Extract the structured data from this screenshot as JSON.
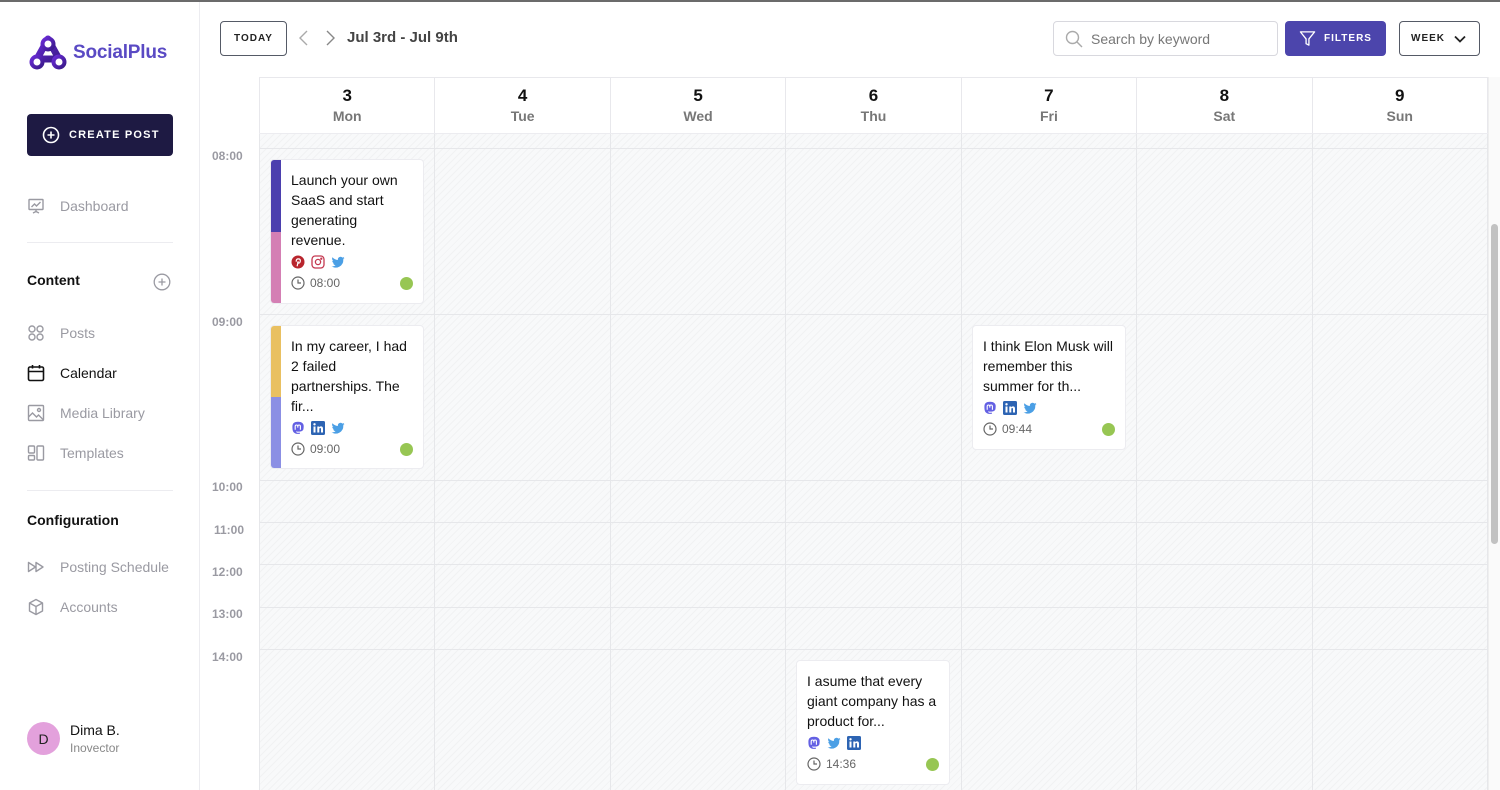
{
  "app": {
    "name": "SocialPlus",
    "brand_color": "#5a4ac4"
  },
  "sidebar": {
    "create_post_label": "CREATE POST",
    "dashboard": {
      "label": "Dashboard",
      "icon": "presentation-chart-icon"
    },
    "content_section": {
      "title": "Content",
      "add_icon": "plus-circle-icon",
      "items": [
        {
          "label": "Posts",
          "icon": "grid-icon",
          "active": false
        },
        {
          "label": "Calendar",
          "icon": "calendar-icon",
          "active": true
        },
        {
          "label": "Media Library",
          "icon": "image-icon",
          "active": false
        },
        {
          "label": "Templates",
          "icon": "templates-icon",
          "active": false
        }
      ]
    },
    "configuration_section": {
      "title": "Configuration",
      "items": [
        {
          "label": "Posting Schedule",
          "icon": "fast-forward-icon"
        },
        {
          "label": "Accounts",
          "icon": "cube-icon"
        }
      ]
    },
    "user": {
      "initial": "D",
      "name": "Dima B.",
      "organization": "Inovector",
      "avatar_color": "#e3a1dc"
    }
  },
  "toolbar": {
    "today_label": "TODAY",
    "date_range": "Jul 3rd - Jul 9th",
    "search_placeholder": "Search by keyword",
    "search_value": "",
    "filters_label": "FILTERS",
    "view_label": "WEEK",
    "accent_color": "#4c45ac"
  },
  "calendar": {
    "days": [
      {
        "num": "3",
        "name": "Mon"
      },
      {
        "num": "4",
        "name": "Tue"
      },
      {
        "num": "5",
        "name": "Wed"
      },
      {
        "num": "6",
        "name": "Thu"
      },
      {
        "num": "7",
        "name": "Fri"
      },
      {
        "num": "8",
        "name": "Sat"
      },
      {
        "num": "9",
        "name": "Sun"
      }
    ],
    "time_slots": [
      "08:00",
      "09:00",
      "10:00",
      "11:00",
      "12:00",
      "13:00",
      "14:00"
    ],
    "posts": [
      {
        "text": "Launch your own SaaS and start generating revenue.",
        "time": "08:00",
        "day": "Mon",
        "networks": [
          "pinterest",
          "instagram",
          "twitter"
        ],
        "account_colors": [
          "#4b3fae",
          "#d47fb4"
        ],
        "status_color": "#97c653"
      },
      {
        "text": "In my career, I had 2 failed partnerships. The fir...",
        "time": "09:00",
        "day": "Mon",
        "networks": [
          "mastodon",
          "linkedin",
          "twitter"
        ],
        "account_colors": [
          "#e9c061",
          "#8b8fe4"
        ],
        "status_color": "#97c653"
      },
      {
        "text": "I think Elon Musk will remember this summer for th...",
        "time": "09:44",
        "day": "Fri",
        "networks": [
          "mastodon",
          "linkedin",
          "twitter"
        ],
        "account_colors": [],
        "status_color": "#97c653"
      },
      {
        "text": "I asume that every giant company has a product for...",
        "time": "14:36",
        "day": "Thu",
        "networks": [
          "mastodon",
          "twitter",
          "linkedin"
        ],
        "account_colors": [],
        "status_color": "#97c653"
      }
    ]
  }
}
